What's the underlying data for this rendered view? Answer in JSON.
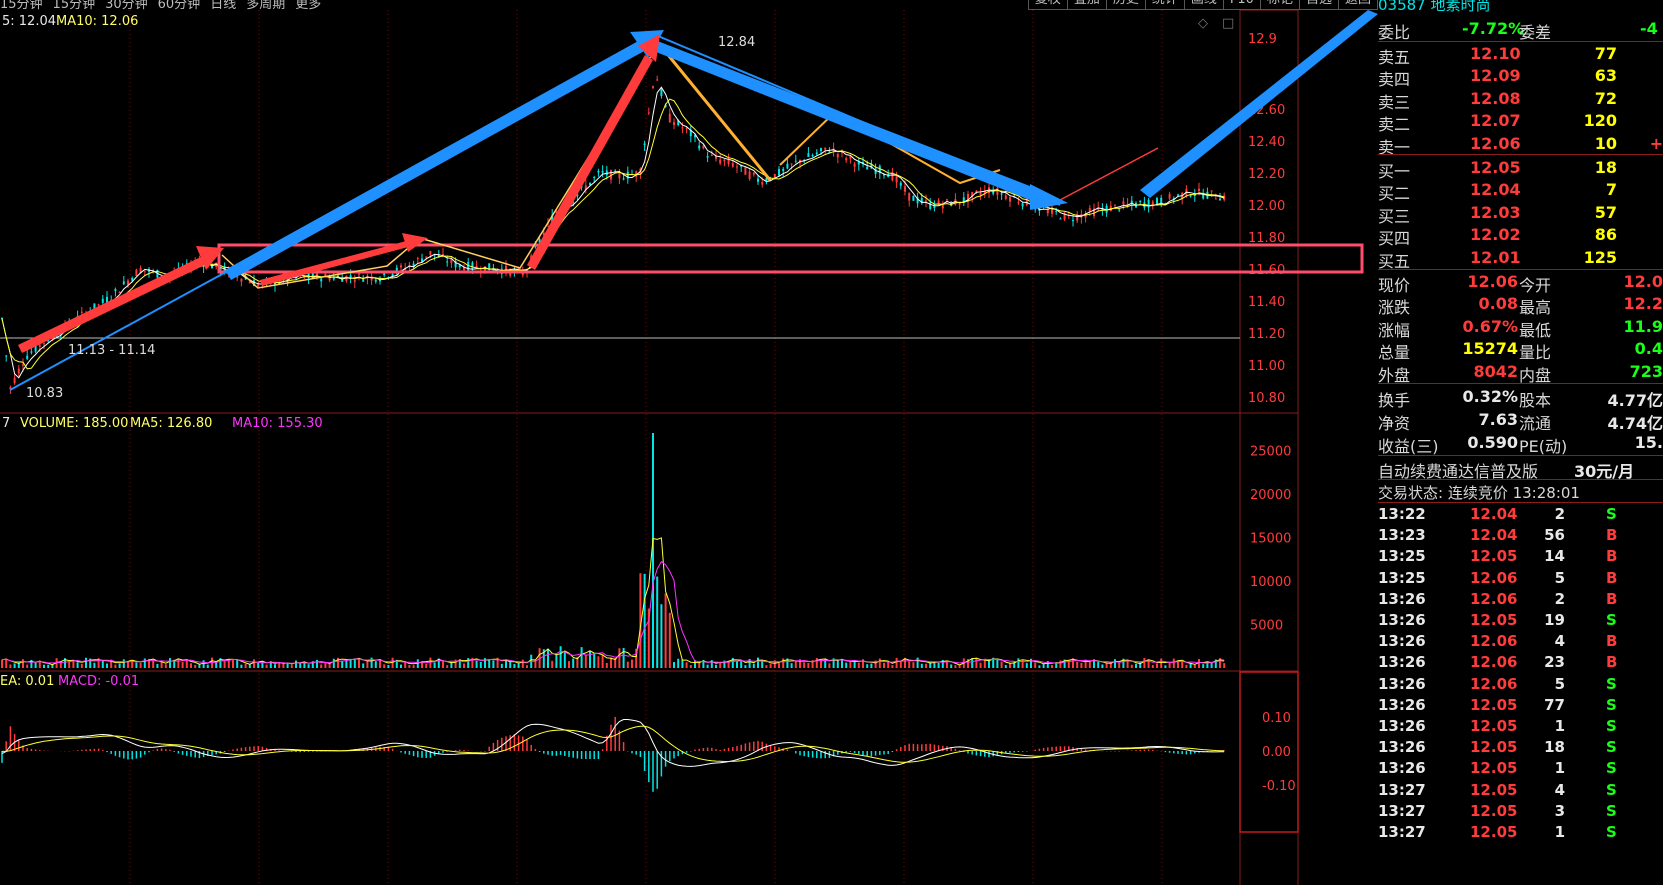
{
  "top_tabs": [
    "15分钟",
    "15分钟",
    "30分钟",
    "60分钟",
    "日线",
    "多周期",
    "更多"
  ],
  "top_buttons": [
    "复权",
    "叠加",
    "历史",
    "统计",
    "画线",
    "F10",
    "标记",
    "自选",
    "返回"
  ],
  "main_chart": {
    "indicator_prefix": "5: 12.04",
    "ma10_label": "MA10: 12.06",
    "y_axis_labels": [
      "12.9",
      "12.60",
      "12.40",
      "12.20",
      "12.00",
      "11.80",
      "11.60",
      "11.40",
      "11.20",
      "11.00",
      "10.80"
    ],
    "high_annotation": "12.84",
    "low_annotation": "10.83",
    "range_annotation": "11.13 - 11.14",
    "price_min": 10.7,
    "price_max": 12.95,
    "colors": {
      "arrow_blue": "#1e90ff",
      "arrow_red": "#ff3b3b",
      "arrow_yellow": "#ffb030",
      "rect_pink": "#ff4d6a"
    }
  },
  "volume_chart": {
    "prefix": "7",
    "volume_label": "VOLUME: 185.00",
    "ma5_label": "MA5: 126.80",
    "ma10_label": "MA10: 155.30",
    "y_axis_labels": [
      "25000",
      "20000",
      "15000",
      "10000",
      "5000"
    ],
    "vol_max": 27000
  },
  "macd_chart": {
    "dea_label": "EA: 0.01",
    "macd_label": "MACD: -0.01",
    "y_axis_labels": [
      "0.10",
      "0.00",
      "-0.10"
    ]
  },
  "quote": {
    "code_name": "03587 地素时尚",
    "wb_label": "委比",
    "wb_value": "-7.72%",
    "wc_label": "委差",
    "wc_value": "-4",
    "asks": [
      {
        "label": "卖五",
        "price": "12.10",
        "vol": "77",
        "extra": ""
      },
      {
        "label": "卖四",
        "price": "12.09",
        "vol": "63",
        "extra": ""
      },
      {
        "label": "卖三",
        "price": "12.08",
        "vol": "72",
        "extra": ""
      },
      {
        "label": "卖二",
        "price": "12.07",
        "vol": "120",
        "extra": ""
      },
      {
        "label": "卖一",
        "price": "12.06",
        "vol": "10",
        "extra": "+"
      }
    ],
    "bids": [
      {
        "label": "买一",
        "price": "12.05",
        "vol": "18"
      },
      {
        "label": "买二",
        "price": "12.04",
        "vol": "7"
      },
      {
        "label": "买三",
        "price": "12.03",
        "vol": "57"
      },
      {
        "label": "买四",
        "price": "12.02",
        "vol": "86"
      },
      {
        "label": "买五",
        "price": "12.01",
        "vol": "125"
      }
    ],
    "stats": [
      {
        "l1": "现价",
        "v1": "12.06",
        "c1": "red",
        "l2": "今开",
        "v2": "12.0",
        "c2": "red"
      },
      {
        "l1": "涨跌",
        "v1": "0.08",
        "c1": "red",
        "l2": "最高",
        "v2": "12.2",
        "c2": "red"
      },
      {
        "l1": "涨幅",
        "v1": "0.67%",
        "c1": "red",
        "l2": "最低",
        "v2": "11.9",
        "c2": "grn"
      },
      {
        "l1": "总量",
        "v1": "15274",
        "c1": "yel",
        "l2": "量比",
        "v2": "0.4",
        "c2": "grn"
      },
      {
        "l1": "外盘",
        "v1": "8042",
        "c1": "red",
        "l2": "内盘",
        "v2": "723",
        "c2": "grn"
      }
    ],
    "stats2": [
      {
        "l1": "换手",
        "v1": "0.32%",
        "l2": "股本",
        "v2": "4.77亿"
      },
      {
        "l1": "净资",
        "v1": "7.63",
        "l2": "流通",
        "v2": "4.74亿"
      },
      {
        "l1": "收益(三)",
        "v1": "0.590",
        "l2": "PE(动)",
        "v2": "15."
      }
    ],
    "ad_text": "自动续费通达信普及版",
    "ad_price": "30元/月",
    "status_text": "交易状态: 连续竞价 13:28:01"
  },
  "ticks": [
    {
      "t": "13:22",
      "p": "12.04",
      "v": "2",
      "s": "S"
    },
    {
      "t": "13:23",
      "p": "12.04",
      "v": "56",
      "s": "B"
    },
    {
      "t": "13:25",
      "p": "12.05",
      "v": "14",
      "s": "B"
    },
    {
      "t": "13:25",
      "p": "12.06",
      "v": "5",
      "s": "B"
    },
    {
      "t": "13:26",
      "p": "12.06",
      "v": "2",
      "s": "B"
    },
    {
      "t": "13:26",
      "p": "12.05",
      "v": "19",
      "s": "S"
    },
    {
      "t": "13:26",
      "p": "12.06",
      "v": "4",
      "s": "B"
    },
    {
      "t": "13:26",
      "p": "12.06",
      "v": "23",
      "s": "B"
    },
    {
      "t": "13:26",
      "p": "12.06",
      "v": "5",
      "s": "S"
    },
    {
      "t": "13:26",
      "p": "12.05",
      "v": "77",
      "s": "S"
    },
    {
      "t": "13:26",
      "p": "12.05",
      "v": "1",
      "s": "S"
    },
    {
      "t": "13:26",
      "p": "12.05",
      "v": "18",
      "s": "S"
    },
    {
      "t": "13:26",
      "p": "12.05",
      "v": "1",
      "s": "S"
    },
    {
      "t": "13:27",
      "p": "12.05",
      "v": "4",
      "s": "S"
    },
    {
      "t": "13:27",
      "p": "12.05",
      "v": "3",
      "s": "S"
    },
    {
      "t": "13:27",
      "p": "12.05",
      "v": "1",
      "s": "S"
    }
  ]
}
